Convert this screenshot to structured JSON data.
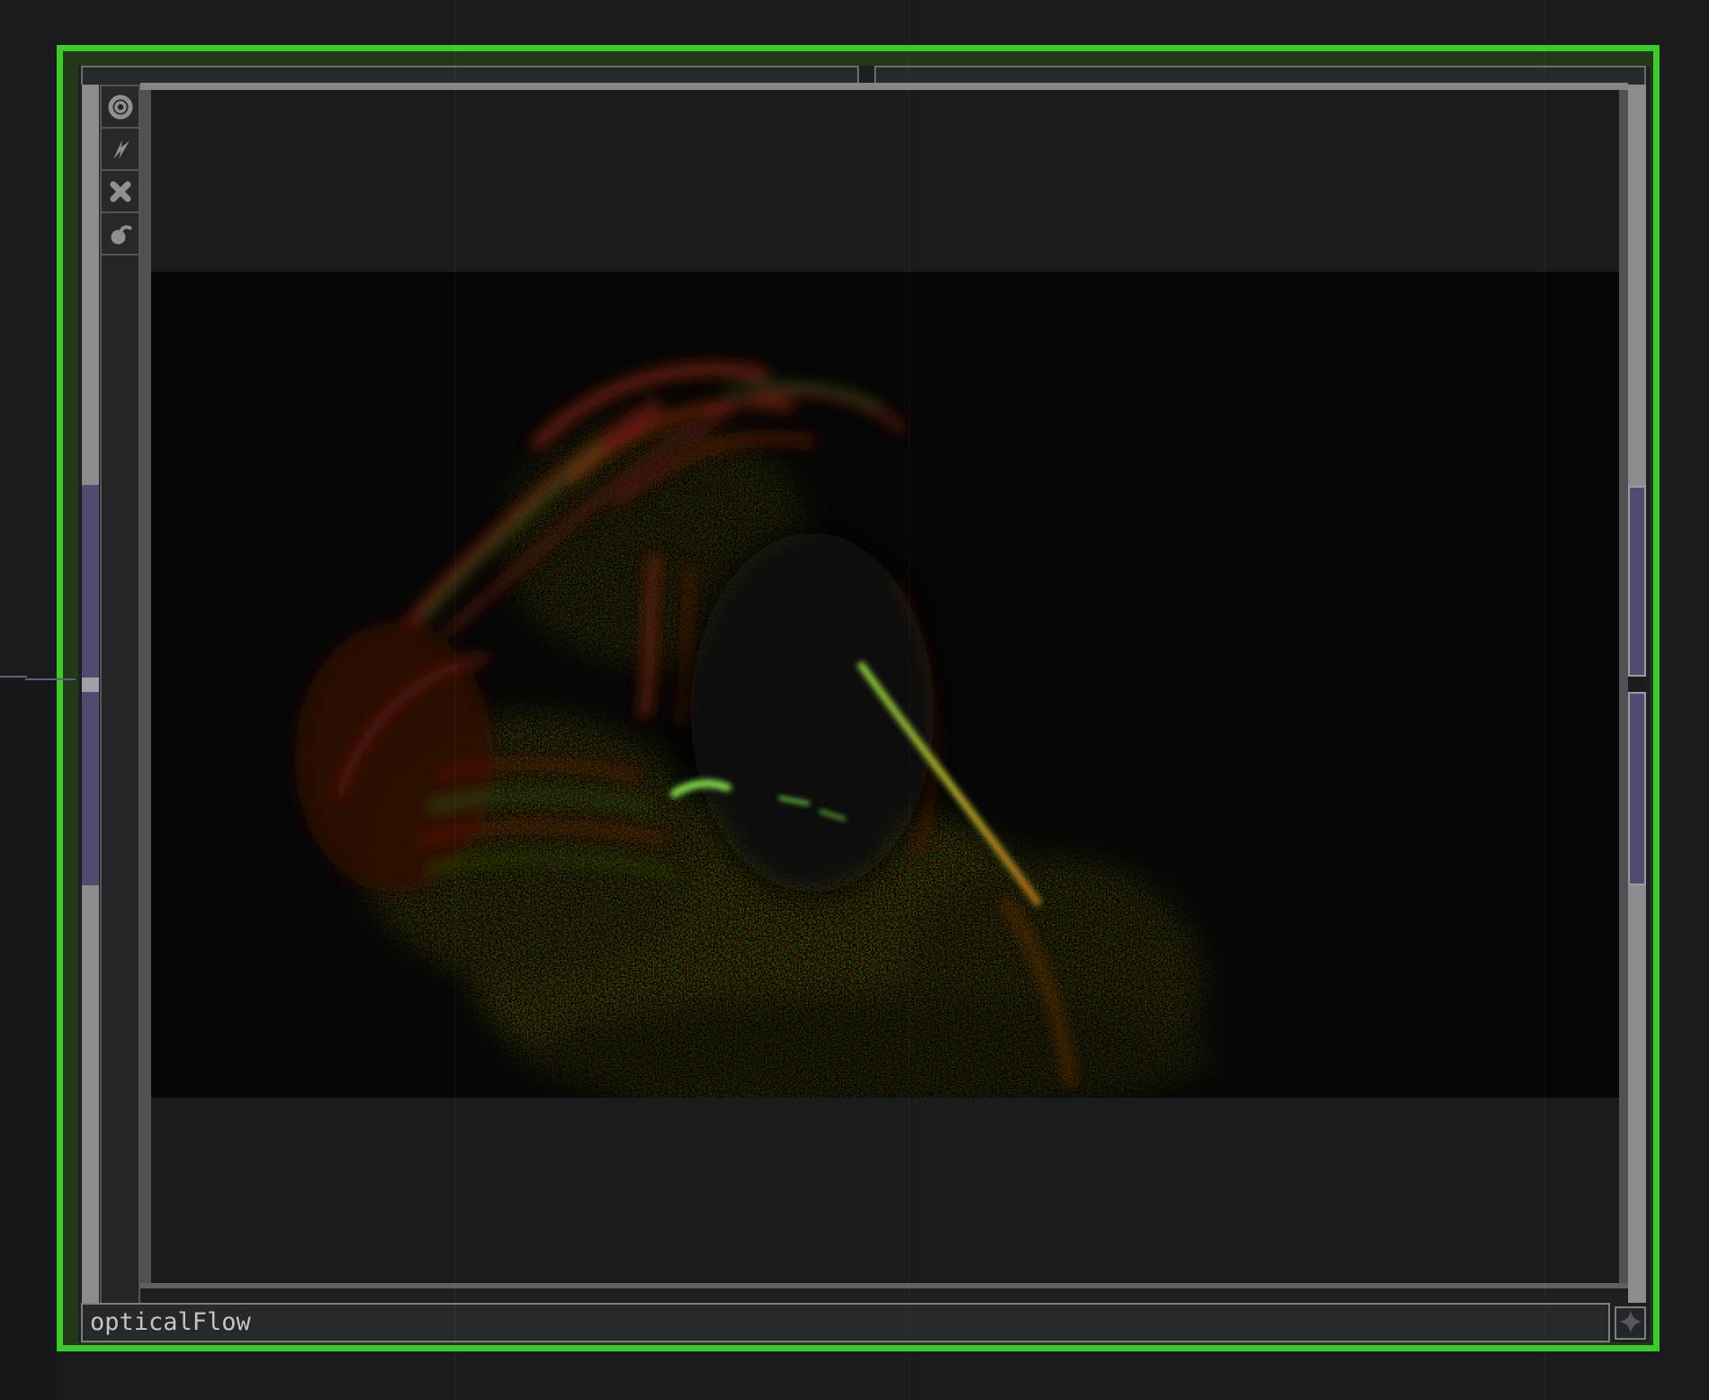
{
  "app": {
    "view": "network-editor-node-zoom"
  },
  "node": {
    "name": "opticalFlow",
    "selected": true,
    "flags": [
      {
        "id": "viewer",
        "icon": "ring-icon"
      },
      {
        "id": "bypass",
        "icon": "lightning-icon"
      },
      {
        "id": "cross",
        "icon": "x-icon"
      },
      {
        "id": "lock",
        "icon": "open-padlock-icon"
      }
    ],
    "inputs": [
      "input-connector-1",
      "input-connector-2"
    ],
    "outputs": [
      "output-connector-1",
      "output-connector-2"
    ],
    "comment_button_icon": "four-point-star-icon"
  },
  "colors": {
    "selection_green": "#3ccb2b",
    "selection_green_dark": "#213918",
    "connector_purple": "#4f4c70",
    "rail_gray": "#8c8c90",
    "wire_purple": "#5f5d85",
    "background": "#191a1c",
    "viewer_background": "#1a1b1d",
    "image_black": "#070707",
    "flow_red": "#5c1708",
    "flow_green": "#7ed04e",
    "flow_orange": "#b36414"
  }
}
